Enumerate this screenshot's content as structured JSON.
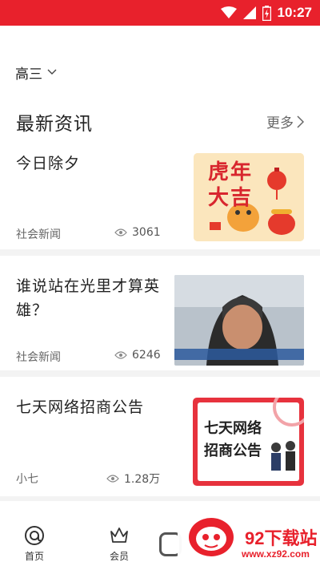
{
  "status_bar": {
    "time": "10:27",
    "bg_color": "#e8212c"
  },
  "grade_selector": {
    "label": "高三",
    "icon": "chevron-down-icon"
  },
  "section": {
    "title": "最新资讯",
    "more_label": "更多"
  },
  "news": [
    {
      "title": "今日除夕",
      "category": "社会新闻",
      "views": "3061",
      "thumb_text": "虎年大吉"
    },
    {
      "title": "谁说站在光里才算英雄？",
      "category": "社会新闻",
      "views": "6246"
    },
    {
      "title": "七天网络招商公告",
      "category": "小七",
      "views": "1.28万",
      "thumb_line1": "七天网络",
      "thumb_line2": "招商公告"
    }
  ],
  "bottom_nav": [
    {
      "label": "首页",
      "icon": "home-at-icon"
    },
    {
      "label": "会员",
      "icon": "crown-icon"
    }
  ],
  "watermark": {
    "brand": "92下载站",
    "url": "www.xz92.com"
  }
}
